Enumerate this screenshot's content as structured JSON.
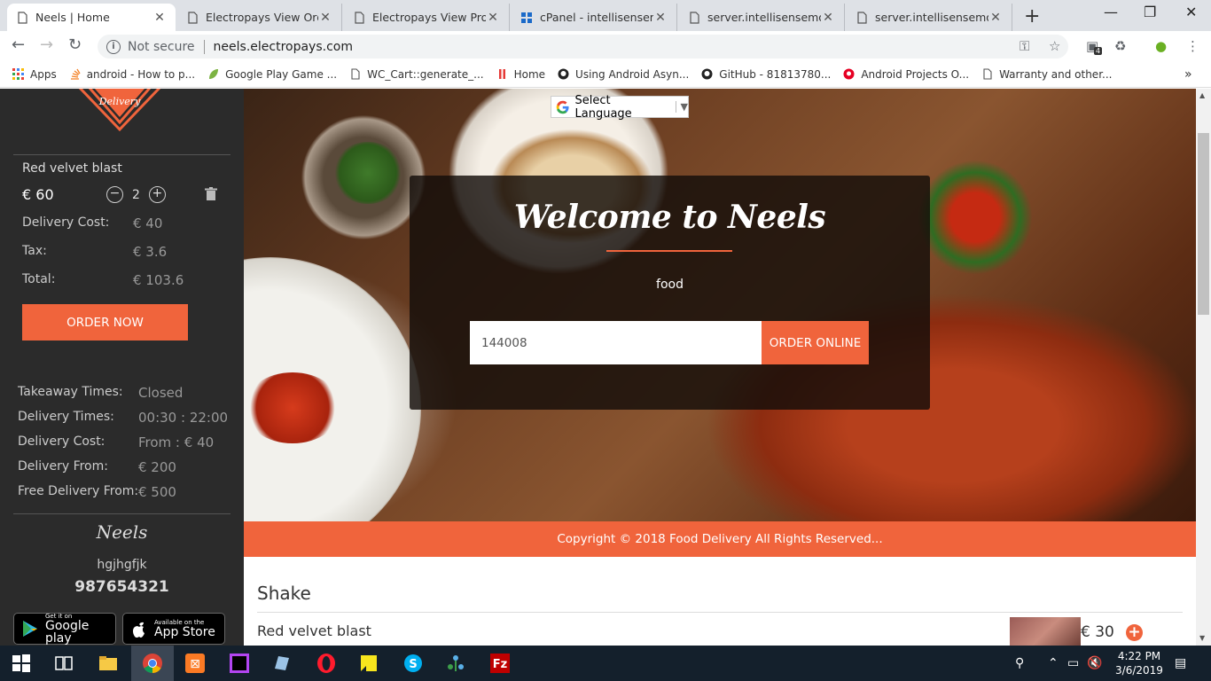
{
  "browser": {
    "tabs": [
      {
        "title": "Neels | Home",
        "active": true
      },
      {
        "title": "Electropays View Order",
        "active": false
      },
      {
        "title": "Electropays View Produ",
        "active": false
      },
      {
        "title": "cPanel - intellisensemol",
        "active": false
      },
      {
        "title": "server.intellisensemobi.",
        "active": false
      },
      {
        "title": "server.intellisensemobi.",
        "active": false
      }
    ],
    "security_label": "Not secure",
    "url": "neels.electropays.com",
    "extension_badge": "4",
    "bookmarks": [
      {
        "label": "Apps"
      },
      {
        "label": "android - How to p..."
      },
      {
        "label": "Google Play Game ..."
      },
      {
        "label": "WC_Cart::generate_..."
      },
      {
        "label": "Home"
      },
      {
        "label": "Using Android Asyn..."
      },
      {
        "label": "GitHub - 81813780..."
      },
      {
        "label": "Android Projects O..."
      },
      {
        "label": "Warranty and other..."
      }
    ],
    "overflow_label": "»"
  },
  "sidebar": {
    "logo_text": "Delivery",
    "cart_item_name": "Red velvet blast",
    "cart_item_price": "€ 60",
    "cart_item_qty": "2",
    "summary": [
      {
        "label": "Delivery Cost:",
        "value": "€ 40"
      },
      {
        "label": "Tax:",
        "value": "€ 3.6"
      },
      {
        "label": "Total:",
        "value": "€ 103.6"
      }
    ],
    "order_now_label": "ORDER NOW",
    "info": [
      {
        "label": "Takeaway Times:",
        "value": "Closed"
      },
      {
        "label": "Delivery Times:",
        "value": "00:30 : 22:00"
      },
      {
        "label": "Delivery Cost:",
        "value": "From : € 40"
      },
      {
        "label": "Delivery From:",
        "value": "€ 200"
      },
      {
        "label": "Free Delivery From:",
        "value": "€ 500"
      }
    ],
    "brand": "Neels",
    "subtitle": "hgjhgfjk",
    "phone": "987654321",
    "google_play_small": "Get it on",
    "google_play_big": "Google play",
    "app_store_small": "Available on the",
    "app_store_big": "App Store"
  },
  "hero": {
    "language_label": "Select Language",
    "title": "Welcome to Neels",
    "subtitle": "food",
    "zip_value": "144008",
    "order_online_label": "ORDER ONLINE"
  },
  "footer": {
    "copyright": "Copyright © 2018 Food Delivery All Rights Reserved..."
  },
  "menu": {
    "category": "Shake",
    "items": [
      {
        "name": "Red velvet blast",
        "price": "€ 30"
      }
    ]
  },
  "taskbar": {
    "time": "4:22 PM",
    "date": "3/6/2019"
  },
  "colors": {
    "accent": "#f0643c",
    "sidebar_bg": "#2b2b2b"
  }
}
